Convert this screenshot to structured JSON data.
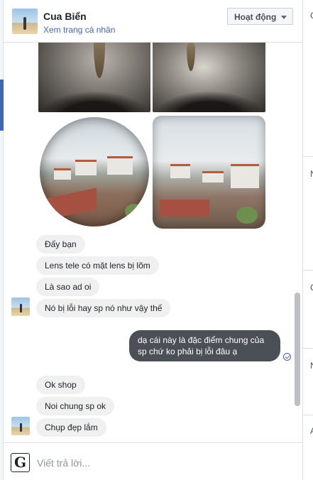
{
  "header": {
    "contact_name": "Cua Biển",
    "profile_link": "Xem trang cá nhân",
    "status_label": "Hoạt động",
    "avatar_icon": "beach-photo-avatar"
  },
  "thread": {
    "incoming_group_1": [
      "Đấy bạn",
      "Lens tele có mặt lens bị lõm",
      "Là sao ad oi",
      "Nó bị lỗi hay sp nó như vậy thế"
    ],
    "outgoing": [
      "dạ cái này là đặc điểm chung của sp chứ ko phải bị lỗi đâu ạ"
    ],
    "incoming_group_2": [
      "Ok shop",
      "Noi chung sp ok",
      "Chụp đẹp lắm"
    ],
    "seen_icon": "seen-check-icon"
  },
  "composer": {
    "placeholder": "Viết trả lời...",
    "grammar_icon": "G"
  },
  "right_pane": {
    "chars": [
      "G",
      "N",
      "C",
      "N",
      "A"
    ]
  },
  "colors": {
    "accent": "#4267b2",
    "outgoing_bubble": "#4b4f56",
    "incoming_bubble": "#f1f0f0"
  }
}
